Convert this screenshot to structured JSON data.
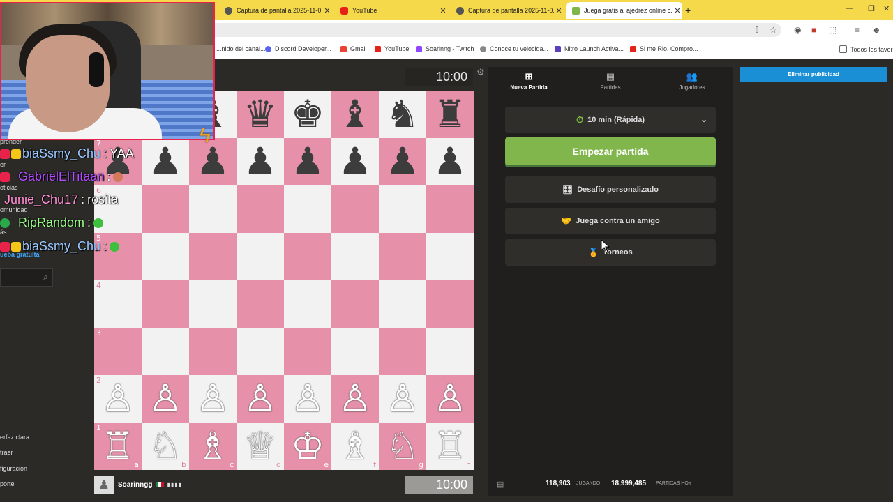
{
  "browser": {
    "tabs": [
      {
        "title": "Captura de pantalla 2025-11-0..."
      },
      {
        "title": "YouTube"
      },
      {
        "title": "Captura de pantalla 2025-11-0..."
      },
      {
        "title": "Juega gratis al ajedrez online c..."
      }
    ],
    "new_tab": "+",
    "bookmarks": [
      "...nido del canal...",
      "Discord Developer...",
      "Gmail",
      "YouTube",
      "Soarinng - Twitch",
      "Conoce tu velocida...",
      "Nitro Launch Activa...",
      "Si me Rio, Compro..."
    ],
    "all_favorites": "Todos los favorit"
  },
  "board": {
    "top_clock": "10:00",
    "bottom_clock": "10:00",
    "ranks": [
      "7",
      "6",
      "5",
      "4",
      "3",
      "2",
      "1"
    ],
    "files": [
      "a",
      "b",
      "c",
      "d",
      "e",
      "f",
      "g",
      "h"
    ],
    "player_name": "Soarinngg",
    "player_bars": "▮▮▮▮",
    "squares": [
      [
        "♜",
        "♞",
        "♝",
        "♛",
        "♚",
        "♝",
        "♞",
        "♜"
      ],
      [
        "♟",
        "♟",
        "♟",
        "♟",
        "♟",
        "♟",
        "♟",
        "♟"
      ],
      [
        "",
        "",
        "",
        "",
        "",
        "",
        "",
        ""
      ],
      [
        "",
        "",
        "",
        "",
        "",
        "",
        "",
        ""
      ],
      [
        "",
        "",
        "",
        "",
        "",
        "",
        "",
        ""
      ],
      [
        "",
        "",
        "",
        "",
        "",
        "",
        "",
        ""
      ],
      [
        "♙",
        "♙",
        "♙",
        "♙",
        "♙",
        "♙",
        "♙",
        "♙"
      ],
      [
        "♖",
        "♘",
        "♗",
        "♕",
        "♔",
        "♗",
        "♘",
        "♖"
      ]
    ]
  },
  "panel": {
    "tabs": [
      {
        "label": "Nueva Partida",
        "icon": "plus-icon"
      },
      {
        "label": "Partidas",
        "icon": "board-icon"
      },
      {
        "label": "Jugadores",
        "icon": "players-icon"
      }
    ],
    "time_control": "10 min (Rápida)",
    "start_label": "Empezar partida",
    "custom_label": "Desafío personalizado",
    "friend_label": "Juega contra un amigo",
    "tournaments_label": "Torneos",
    "playing_count": "118,903",
    "playing_label": "JUGANDO",
    "games_today_count": "18,999,485",
    "games_today_label": "PARTIDAS HOY",
    "ad_label": "Eliminar publicidad"
  },
  "left_sidebar": {
    "items": [
      "prender",
      "er",
      "oticias",
      "omunidad",
      "ás",
      "ueba gratuita",
      "erfaz clara",
      "traer",
      "figuración",
      "porte"
    ]
  },
  "chat": [
    {
      "user": "biaSsmy_Chu",
      "message": "YAA",
      "color": "#9cc7ff"
    },
    {
      "user": "GabrielElTitaan",
      "message": "",
      "color": "#b44cff"
    },
    {
      "user": "Junie_Chu17",
      "message": "rosita",
      "color": "#ff8fd3"
    },
    {
      "user": "RipRandom",
      "message": "",
      "color": "#9cff8a"
    },
    {
      "user": "biaSsmy_Chu",
      "message": "",
      "color": "#9cc7ff"
    }
  ],
  "colors": {
    "board_light": "#f2f2f2",
    "board_dark": "#e790a9",
    "start_button": "#81b64c",
    "ad_button": "#1a8fd6",
    "tab_bar": "#f6d94a"
  }
}
